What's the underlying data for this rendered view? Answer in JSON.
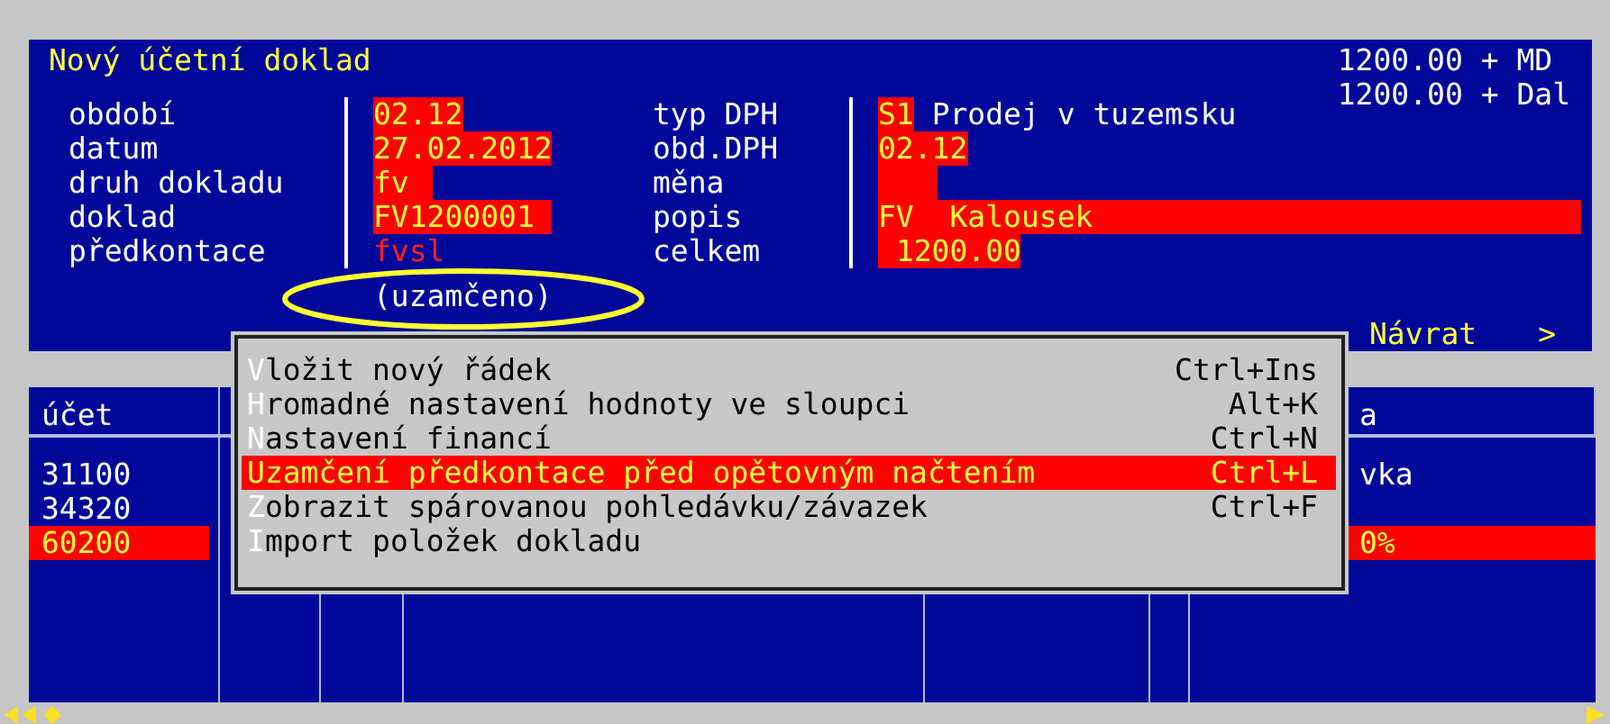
{
  "header": {
    "title": "Nový účetní doklad",
    "totals": [
      "1200.00 + MD",
      "1200.00 + Dal"
    ]
  },
  "form_left": [
    {
      "label": "období",
      "value": "02.12",
      "kind": "field"
    },
    {
      "label": "datum",
      "value": "27.02.2012",
      "kind": "field"
    },
    {
      "label": "druh dokladu",
      "value": "fv",
      "kind": "field"
    },
    {
      "label": "doklad",
      "value": "FV1200001",
      "kind": "field"
    },
    {
      "label": "předkontace",
      "value": "fvsl",
      "kind": "locked",
      "note": "(uzamčeno)"
    }
  ],
  "form_right": [
    {
      "label": "typ DPH",
      "code": "S1",
      "value": "Prodej v tuzemsku",
      "kind": "coded"
    },
    {
      "label": "obd.DPH",
      "value": "02.12",
      "kind": "field"
    },
    {
      "label": "měna",
      "kind": "empty"
    },
    {
      "label": "popis",
      "code": "FV",
      "value": "Kalousek",
      "kind": "wide"
    },
    {
      "label": "celkem",
      "value": "1200.00",
      "kind": "amount"
    }
  ],
  "actions": [
    {
      "label": "Návrat"
    },
    {
      "label": ">"
    }
  ],
  "table": {
    "columns": [
      "účet",
      "a"
    ],
    "rows": [
      {
        "cells": [
          "31100",
          "vka"
        ],
        "selected": false
      },
      {
        "cells": [
          "34320",
          null
        ],
        "selected": false
      },
      {
        "cells": [
          "60200",
          "0%"
        ],
        "selected": true
      }
    ]
  },
  "context_menu": {
    "items": [
      {
        "label": "Vložit nový řádek",
        "shortcut": "Ctrl+Ins",
        "selected": false
      },
      {
        "label": "Hromadné nastavení hodnoty ve sloupci",
        "shortcut": "Alt+K",
        "selected": false
      },
      {
        "label": "Nastavení financí",
        "shortcut": "Ctrl+N",
        "selected": false
      },
      {
        "label": "Uzamčení předkontace před opětovným načtením",
        "shortcut": "Ctrl+L",
        "selected": true
      },
      {
        "label": "Zobrazit spárovanou pohledávku/závazek",
        "shortcut": "Ctrl+F",
        "selected": false
      },
      {
        "label": "Import položek dokladu",
        "selected": false
      }
    ]
  }
}
